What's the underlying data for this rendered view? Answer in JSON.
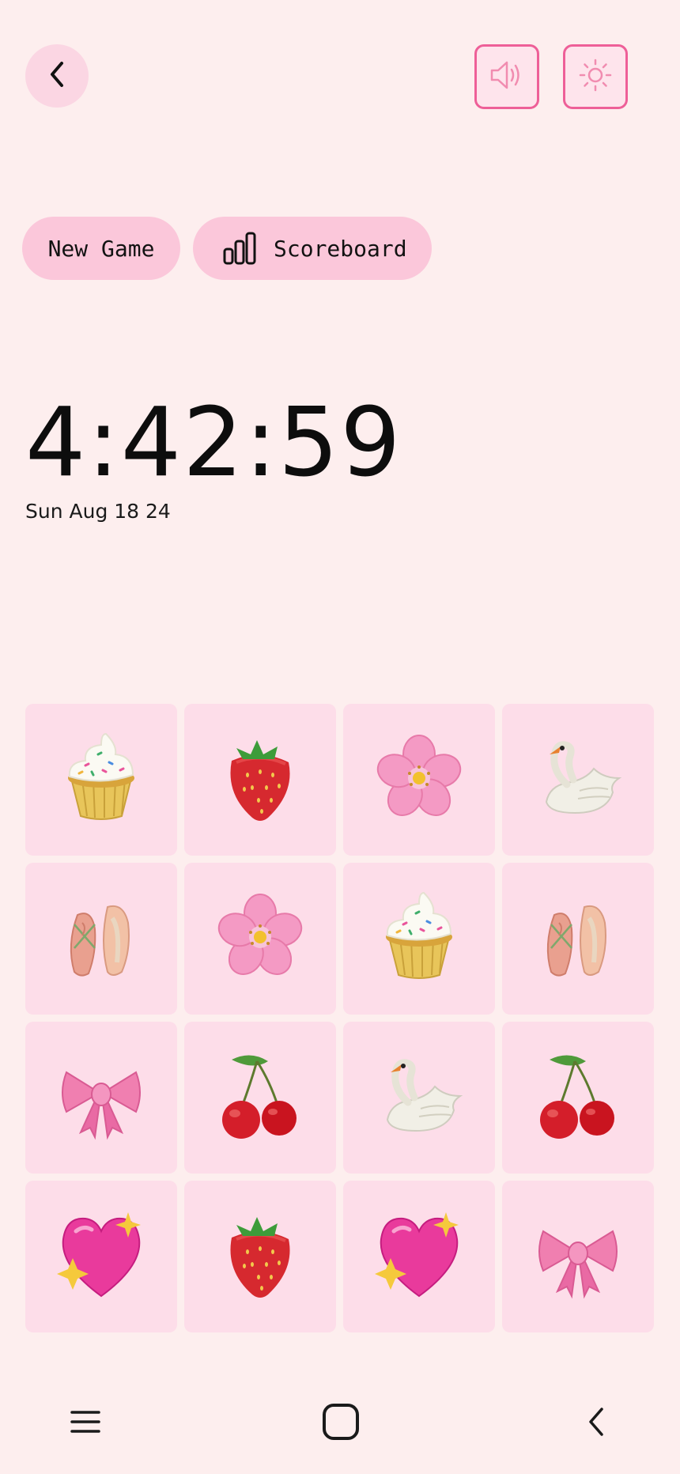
{
  "header": {
    "back_icon": "chevron-left-icon",
    "sound_icon": "speaker-icon",
    "theme_icon": "sun-icon"
  },
  "actions": {
    "new_game_label": "New Game",
    "scoreboard_label": "Scoreboard",
    "scoreboard_icon": "bar-chart-icon"
  },
  "clock": {
    "time": "4:42:59",
    "date": "Sun Aug 18 24"
  },
  "board": {
    "tiles": [
      "cupcake",
      "strawberry",
      "cherry-blossom",
      "swan",
      "ballet-shoes",
      "cherry-blossom",
      "cupcake",
      "ballet-shoes",
      "ribbon-bow",
      "cherries",
      "swan",
      "cherries",
      "sparkling-heart",
      "strawberry",
      "sparkling-heart",
      "ribbon-bow"
    ]
  },
  "nav": {
    "menu_icon": "menu-icon",
    "home_icon": "home-icon",
    "back_icon": "back-icon"
  },
  "colors": {
    "background": "#fdeeee",
    "accent": "#ee5f98",
    "pill": "#fbc7da",
    "tile": "#fddde9"
  }
}
